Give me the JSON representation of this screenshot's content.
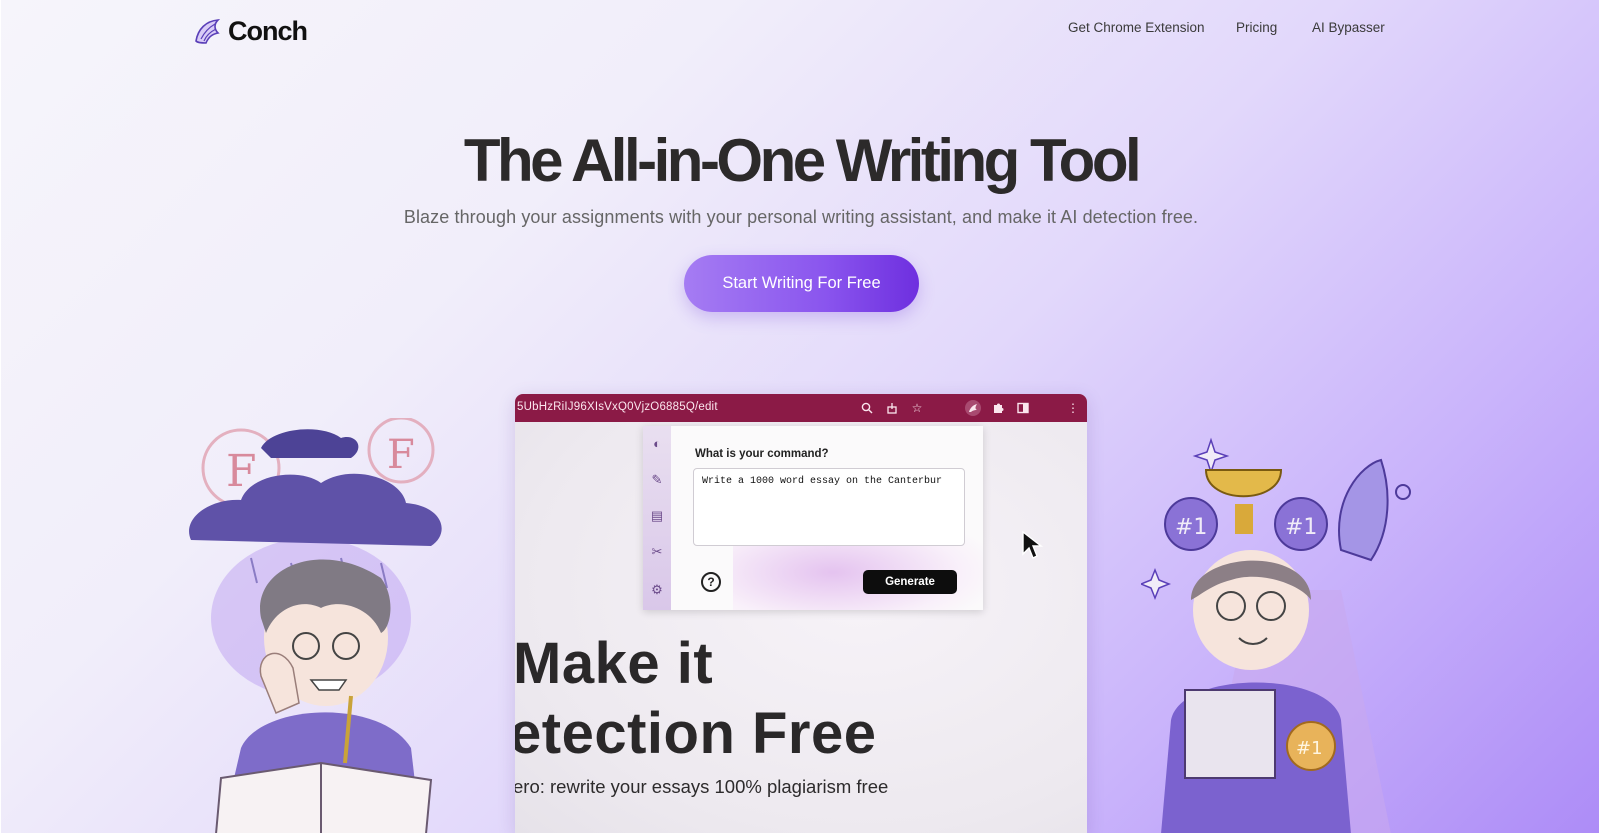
{
  "brand": {
    "name": "Conch",
    "logo_icon": "conch-shell-icon",
    "accent": "#7c3aed"
  },
  "nav": {
    "items": [
      {
        "label": "Get Chrome Extension"
      },
      {
        "label": "Pricing"
      },
      {
        "label": "AI Bypasser"
      }
    ]
  },
  "hero": {
    "title": "The All-in-One Writing Tool",
    "subtitle": "Blaze through your assignments with your personal writing assistant, and make it AI detection free.",
    "cta_label": "Start Writing For Free"
  },
  "demo": {
    "url": "5UbHzRiIJ96XIsVxQ0VjzO6885Q/edit",
    "toolbar_icons": [
      "zoom-icon",
      "share-icon",
      "star-icon",
      "conch-extension-icon",
      "puzzle-icon",
      "sidebar-icon",
      "more-icon"
    ],
    "panel": {
      "question": "What is your command?",
      "input_value": "Write a 1000 word essay on the Canterbur",
      "generate_label": "Generate",
      "side_icons": [
        "conch-icon",
        "pencil-icon",
        "document-icon",
        "scissors-icon",
        "gear-icon"
      ],
      "help_glyph": "?"
    },
    "headline_line1": "Make it",
    "headline_line2": "etection Free",
    "tagline": "ero: rewrite your essays 100% plagiarism free"
  },
  "illustrations": {
    "left": {
      "grades": [
        "F",
        "F"
      ]
    },
    "right": {
      "badges": [
        "#1",
        "#1",
        "#1"
      ]
    }
  }
}
